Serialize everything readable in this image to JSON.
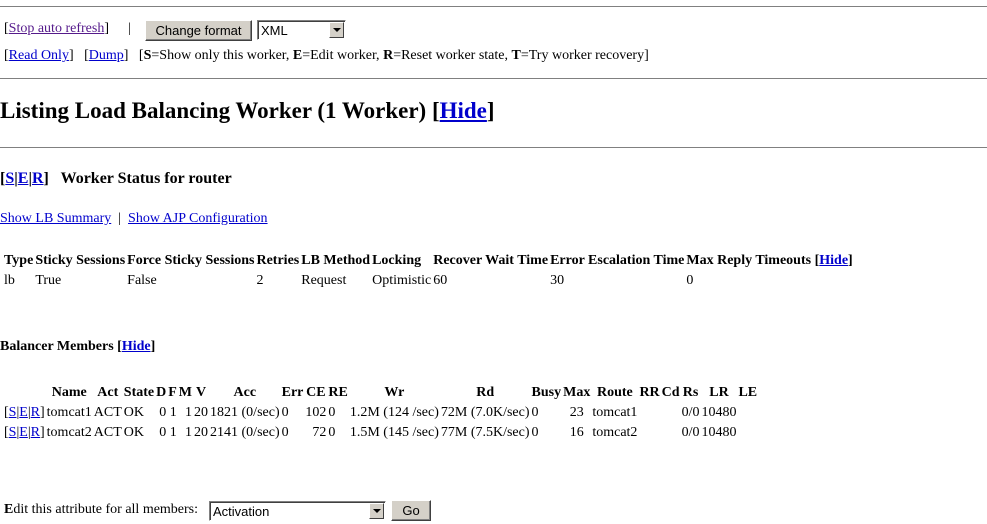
{
  "controls": {
    "stop_refresh": "Stop auto refresh",
    "separator": "|",
    "change_format_button": "Change format",
    "format_selected": "XML",
    "read_only": "Read Only",
    "dump": "Dump",
    "legend_S_key": "S",
    "legend_S_text": "=Show only this worker, ",
    "legend_E_key": "E",
    "legend_E_text": "=Edit worker, ",
    "legend_R_key": "R",
    "legend_R_text": "=Reset worker state, ",
    "legend_T_key": "T",
    "legend_T_text": "=Try worker recovery"
  },
  "listing": {
    "title": "Listing Load Balancing Worker (1 Worker)",
    "hide": "Hide"
  },
  "worker": {
    "actions": [
      "S",
      "E",
      "R"
    ],
    "status_title": "Worker Status for router",
    "show_lb_summary": "Show LB Summary",
    "separator": "|",
    "show_ajp_config": "Show AJP Configuration"
  },
  "lb_table": {
    "headers": [
      "Type",
      "Sticky Sessions",
      "Force Sticky Sessions",
      "Retries",
      "LB Method",
      "Locking",
      "Recover Wait Time",
      "Error Escalation Time",
      "Max Reply Timeouts"
    ],
    "hide": "Hide",
    "row": [
      "lb",
      "True",
      "False",
      "2",
      "Request",
      "Optimistic",
      "60",
      "30",
      "0"
    ]
  },
  "members": {
    "title": "Balancer Members",
    "hide": "Hide",
    "headers": [
      "Name",
      "Act",
      "State",
      "D",
      "F",
      "M",
      "V",
      "Acc",
      "Err",
      "CE",
      "RE",
      "Wr",
      "Rd",
      "Busy",
      "Max",
      "Route",
      "RR",
      "Cd",
      "Rs",
      "LR",
      "LE"
    ],
    "rows": [
      {
        "actions": [
          "S",
          "E",
          "R"
        ],
        "cells": [
          "tomcat1",
          "ACT",
          "OK",
          "0",
          "1",
          "1",
          "20",
          "1821 (0/sec)",
          "0",
          "102",
          "0",
          "1.2M (124 /sec)",
          "72M (7.0K/sec)",
          "0",
          "23",
          "tomcat1",
          "",
          "",
          "0/0",
          "10480",
          ""
        ]
      },
      {
        "actions": [
          "S",
          "E",
          "R"
        ],
        "cells": [
          "tomcat2",
          "ACT",
          "OK",
          "0",
          "1",
          "1",
          "20",
          "2141 (0/sec)",
          "0",
          "72",
          "0",
          "1.5M (145 /sec)",
          "77M (7.5K/sec)",
          "0",
          "16",
          "tomcat2",
          "",
          "",
          "0/0",
          "10480",
          ""
        ]
      }
    ]
  },
  "edit": {
    "label_first": "E",
    "label_rest": "dit this attribute for all members:",
    "selected": "Activation",
    "go_button": "Go"
  }
}
